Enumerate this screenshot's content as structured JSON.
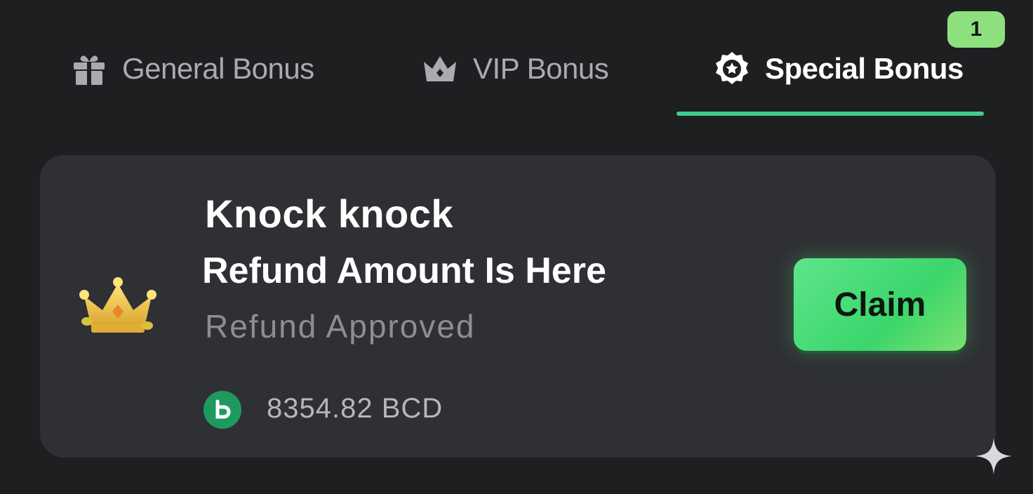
{
  "tabs": [
    {
      "label": "General Bonus",
      "icon": "gift-icon",
      "active": false
    },
    {
      "label": "VIP Bonus",
      "icon": "crown-icon",
      "active": false
    },
    {
      "label": "Special Bonus",
      "icon": "star-badge-icon",
      "active": true
    }
  ],
  "special_badge": "1",
  "card": {
    "icon": "crown-icon",
    "title_line1": "Knock knock",
    "title_line2": "Refund Amount Is Here",
    "subtitle": "Refund Approved",
    "currency_icon": "bcd-coin-icon",
    "amount": "8354.82 BCD",
    "claim_label": "Claim"
  },
  "colors": {
    "background": "#1e1f21",
    "card": "#2f3034",
    "accent": "#3ecf8e",
    "claim_button": "#4fdc7a",
    "badge": "#8ee07f"
  }
}
